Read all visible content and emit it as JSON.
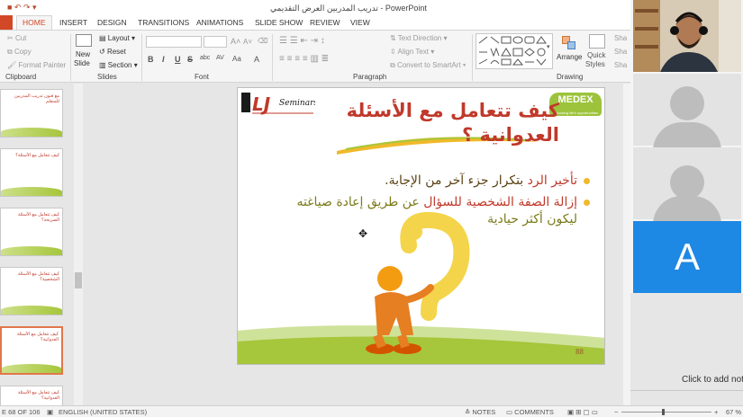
{
  "window": {
    "title": "تدريب المدربين العرض التقديمي - PowerPoint"
  },
  "tabs": [
    "HOME",
    "INSERT",
    "DESIGN",
    "TRANSITIONS",
    "ANIMATIONS",
    "SLIDE SHOW",
    "REVIEW",
    "VIEW"
  ],
  "ribbon": {
    "clipboard": {
      "cut": "Cut",
      "copy": "Copy",
      "format_painter": "Format Painter",
      "label": "Clipboard"
    },
    "slides": {
      "new_slide": "New",
      "new_slide2": "Slide",
      "layout": "Layout",
      "reset": "Reset",
      "section": "Section",
      "label": "Slides"
    },
    "font": {
      "label": "Font",
      "bold": "B",
      "italic": "I",
      "underline": "U",
      "strike": "S",
      "shadow": "abc",
      "spacing": "AV",
      "case": "Aa",
      "color": "A",
      "grow": "A",
      "shrink": "A"
    },
    "paragraph": {
      "text_direction": "Text Direction",
      "align_text": "Align Text",
      "convert_smartart": "Convert to SmartArt",
      "label": "Paragraph"
    },
    "drawing": {
      "arrange": "Arrange",
      "quick_styles": "Quick",
      "quick_styles2": "Styles",
      "label": "Drawing",
      "sha1": "Sha",
      "sha2": "Sha",
      "sha3": "Sha"
    }
  },
  "thumbnails": [
    {
      "title": "مع فنون تدريب المدربين للمتعلم"
    },
    {
      "title": "كيف تتعامل مع الأسئلة؟"
    },
    {
      "title": "كيف تتعامل مع الأسئلة الصريحة؟"
    },
    {
      "title": "كيف تتعامل مع الأسئلة الشخصية؟"
    },
    {
      "title": "كيف تتعامل مع الأسئلة العدوانية؟"
    },
    {
      "title": "كيف تتعامل مع الأسئلة العدوانية؟"
    }
  ],
  "slide": {
    "title": "كيف تتعامل مع الأسئلة العدوانية ؟",
    "logo_left": "LJ Seminars",
    "logo_right": "MEDEX",
    "logo_right_sub": "unlocking life's opportunities",
    "bullet1": {
      "part1": "تأخير الرد",
      "part2": " بتكرار جزء آخر من الإجابة."
    },
    "bullet2": {
      "part1": "إزالة الصفة الشخصية للسؤال",
      "part2": " عن طريق إعادة صياغته ليكون أكثر حيادية"
    },
    "number": "88"
  },
  "notes_hint": "Click to add note",
  "status": {
    "slide_counter": "E 68 OF 106",
    "language": "ENGLISH (UNITED STATES)",
    "notes": "NOTES",
    "comments": "COMMENTS",
    "zoom": "67 %"
  },
  "video": {
    "participant_initial": "A"
  },
  "colors": {
    "accent": "#d24726",
    "title_red": "#c0392b",
    "bullet_yellow": "#f0b92a",
    "participant_blue": "#1e88e5"
  }
}
